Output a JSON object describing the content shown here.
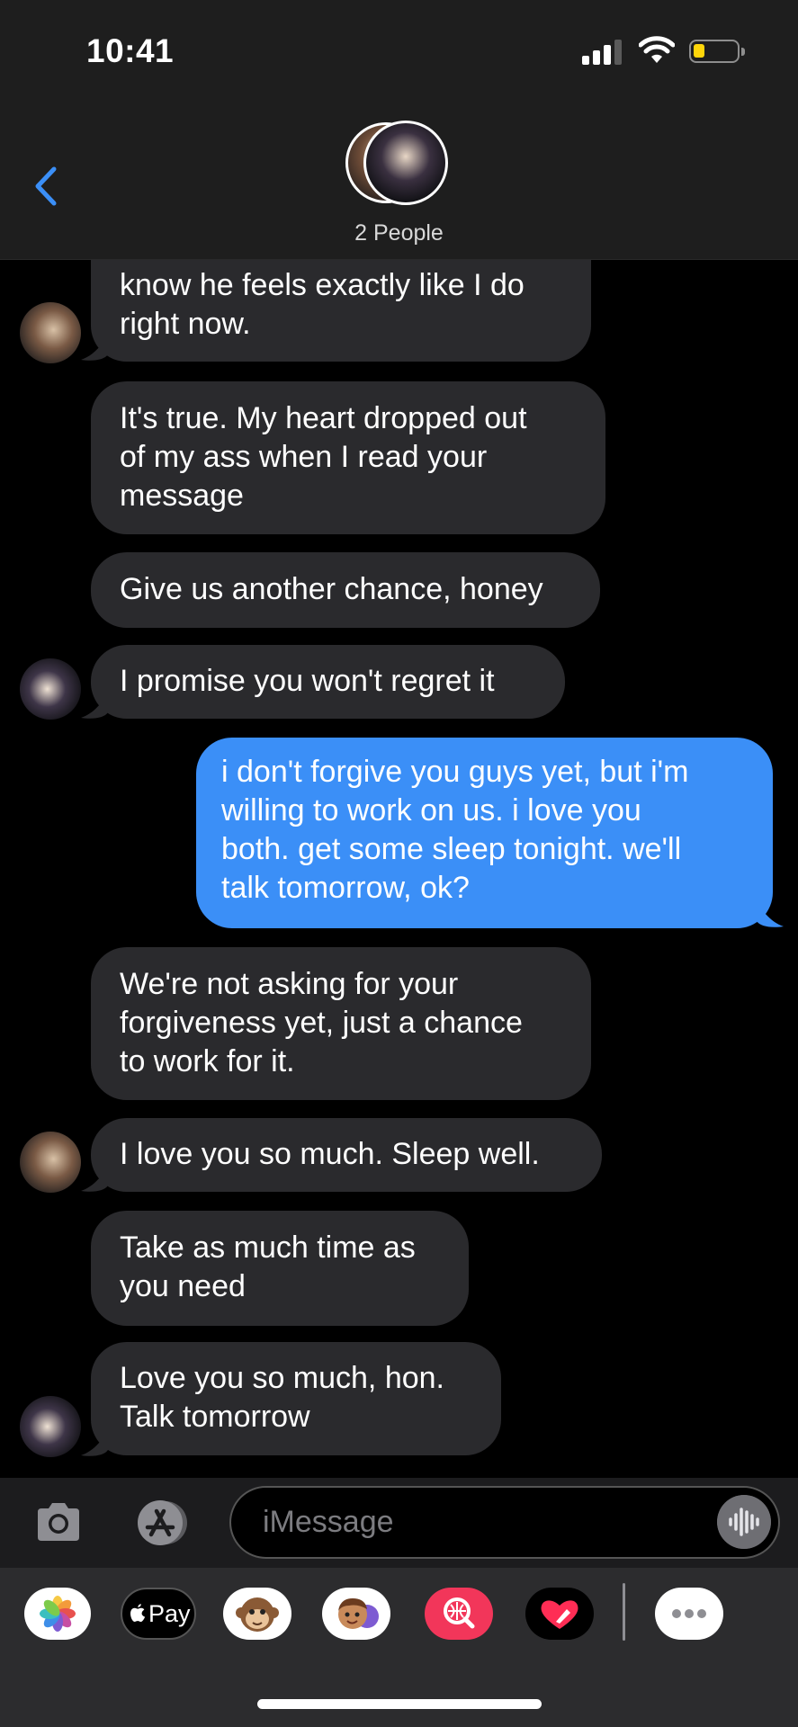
{
  "status": {
    "time": "10:41"
  },
  "header": {
    "group_label": "2 People"
  },
  "messages": [
    {
      "side": "in",
      "text": "know he feels exactly like I do\nright now."
    },
    {
      "side": "in",
      "text": "It's true. My heart dropped out\nof my ass when I read your\nmessage"
    },
    {
      "side": "in",
      "text": "Give us another chance, honey"
    },
    {
      "side": "in",
      "text": "I promise you won't regret it"
    },
    {
      "side": "out",
      "text": "i don't forgive you guys yet, but i'm\nwilling to work on us. i love you\nboth. get some sleep tonight. we'll\ntalk tomorrow, ok?"
    },
    {
      "side": "in",
      "text": "We're not asking for your\nforgiveness yet, just a chance\nto work for it."
    },
    {
      "side": "in",
      "text": "I love you so much. Sleep well."
    },
    {
      "side": "in",
      "text": "Take as much time as\nyou need"
    },
    {
      "side": "in",
      "text": "Love you so much, hon.\nTalk tomorrow"
    }
  ],
  "input": {
    "placeholder": "iMessage"
  },
  "drawer": {
    "apple_pay_label": "Pay",
    "apps": [
      "photos-app",
      "apple-pay-app",
      "animoji-app",
      "memoji-app",
      "image-search-app",
      "digital-touch-app",
      "more-apps"
    ]
  },
  "colors": {
    "sent_bubble": "#3b8ff7",
    "received_bubble": "#2a2a2d",
    "accent": "#3b8ff7"
  }
}
